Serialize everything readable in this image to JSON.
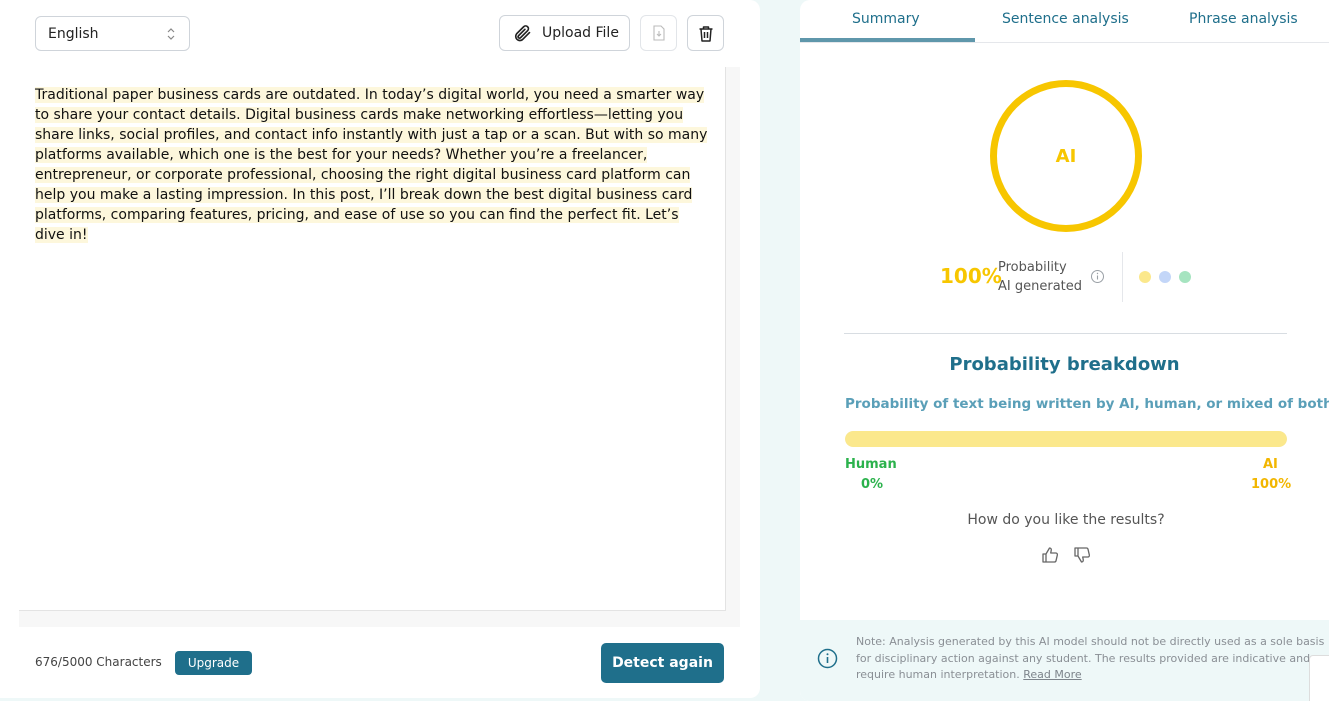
{
  "editor": {
    "language": "English",
    "upload_label": "Upload File",
    "text": "Traditional paper business cards are outdated. In today’s digital world, you need a smarter way to share your contact details. Digital business cards make networking effortless—letting you share links, social profiles, and contact info instantly with just a tap or a scan. But with so many platforms available, which one is the best for your needs? Whether you’re a freelancer, entrepreneur, or corporate professional, choosing the right digital business card platform can help you make a lasting impression. In this post, I’ll break down the best digital business card platforms, comparing features, pricing, and ease of use so you can find the perfect fit. Let’s dive in!",
    "char_count": "676/5000 Characters",
    "upgrade_label": "Upgrade",
    "detect_label": "Detect again"
  },
  "tabs": [
    {
      "label": "Summary",
      "active": true
    },
    {
      "label": "Sentence analysis",
      "active": false
    },
    {
      "label": "Phrase analysis",
      "active": false
    }
  ],
  "summary": {
    "gauge_label": "AI",
    "percent": "100%",
    "prob_line1": "Probability",
    "prob_line2": "AI generated",
    "legend_colors": [
      "#fbe88c",
      "#c3d6f8",
      "#a6e4c0"
    ],
    "accent_color": "#f7c600"
  },
  "breakdown": {
    "title": "Probability breakdown",
    "subtitle": "Probability of text being written by AI, human, or mixed of both",
    "ai_fraction": 1.0,
    "human_label": "Human",
    "human_value": "0%",
    "ai_label": "AI",
    "ai_value": "100%"
  },
  "feedback": {
    "question": "How do you like the results?",
    "icons": [
      "thumbs-up-icon",
      "thumbs-down-icon"
    ]
  },
  "note": {
    "text": "Note: Analysis generated by this AI model should not be directly used as a sole basis for disciplinary action against any student. The results provided are indicative and require human interpretation.",
    "link": "Read More"
  },
  "colors": {
    "primary": "#1f6f8b",
    "human": "#2bb24c",
    "ai": "#f2b600"
  }
}
